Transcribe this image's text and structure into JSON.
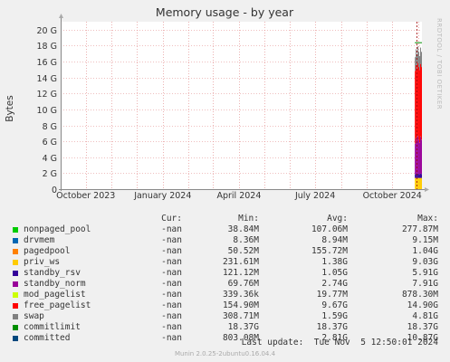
{
  "chart_data": {
    "type": "area",
    "title": "Memory usage - by year",
    "ylabel": "Bytes",
    "ylim": [
      0,
      21
    ],
    "y_ticks": [
      {
        "value": 0,
        "label": "0"
      },
      {
        "value": 2,
        "label": "2 G"
      },
      {
        "value": 4,
        "label": "4 G"
      },
      {
        "value": 6,
        "label": "6 G"
      },
      {
        "value": 8,
        "label": "8 G"
      },
      {
        "value": 10,
        "label": "10 G"
      },
      {
        "value": 12,
        "label": "12 G"
      },
      {
        "value": 14,
        "label": "14 G"
      },
      {
        "value": 16,
        "label": "16 G"
      },
      {
        "value": 18,
        "label": "18 G"
      },
      {
        "value": 20,
        "label": "20 G"
      }
    ],
    "x_ticks": [
      "October 2023",
      "January 2024",
      "April 2024",
      "July 2024",
      "October 2024"
    ],
    "grid": true,
    "stack_order": [
      "priv_ws",
      "standby_rsv",
      "standby_norm",
      "mod_pagelist",
      "free_pagelist",
      "swap"
    ],
    "stack_gb_at_end": {
      "priv_ws": 1.4,
      "standby_rsv": 0.5,
      "standby_norm": 4.3,
      "mod_pagelist": 0.02,
      "free_pagelist": 9.1,
      "swap": 1.9
    },
    "commitlimit_gb": 18.37,
    "series": [
      {
        "name": "nonpaged_pool",
        "color": "#00cc00",
        "cur": "-nan",
        "min": "38.84M",
        "avg": "107.06M",
        "max": "277.87M"
      },
      {
        "name": "drvmem",
        "color": "#0066b3",
        "cur": "-nan",
        "min": "8.36M",
        "avg": "8.94M",
        "max": "9.15M"
      },
      {
        "name": "pagedpool",
        "color": "#ff8000",
        "cur": "-nan",
        "min": "50.52M",
        "avg": "155.72M",
        "max": "1.04G"
      },
      {
        "name": "priv_ws",
        "color": "#ffcc00",
        "cur": "-nan",
        "min": "231.61M",
        "avg": "1.38G",
        "max": "9.03G"
      },
      {
        "name": "standby_rsv",
        "color": "#330099",
        "cur": "-nan",
        "min": "121.12M",
        "avg": "1.05G",
        "max": "5.91G"
      },
      {
        "name": "standby_norm",
        "color": "#990099",
        "cur": "-nan",
        "min": "69.76M",
        "avg": "2.74G",
        "max": "7.91G"
      },
      {
        "name": "mod_pagelist",
        "color": "#ccff00",
        "cur": "-nan",
        "min": "339.36k",
        "avg": "19.77M",
        "max": "878.30M"
      },
      {
        "name": "free_pagelist",
        "color": "#ff0000",
        "cur": "-nan",
        "min": "154.90M",
        "avg": "9.67G",
        "max": "14.90G"
      },
      {
        "name": "swap",
        "color": "#808080",
        "cur": "-nan",
        "min": "308.71M",
        "avg": "1.59G",
        "max": "4.81G"
      },
      {
        "name": "commitlimit",
        "color": "#008f00",
        "cur": "-nan",
        "min": "18.37G",
        "avg": "18.37G",
        "max": "18.37G"
      },
      {
        "name": "committed",
        "color": "#00487d",
        "cur": "-nan",
        "min": "803.08M",
        "avg": "2.81G",
        "max": "10.87G"
      }
    ]
  },
  "legend_headers": {
    "cur": "Cur:",
    "min": "Min:",
    "avg": "Avg:",
    "max": "Max:"
  },
  "last_update": "Last update:  Tue Nov  5 12:50:01 2024",
  "footer": "Munin 2.0.25-2ubuntu0.16.04.4",
  "watermark": "RRDTOOL / TOBI OETIKER"
}
